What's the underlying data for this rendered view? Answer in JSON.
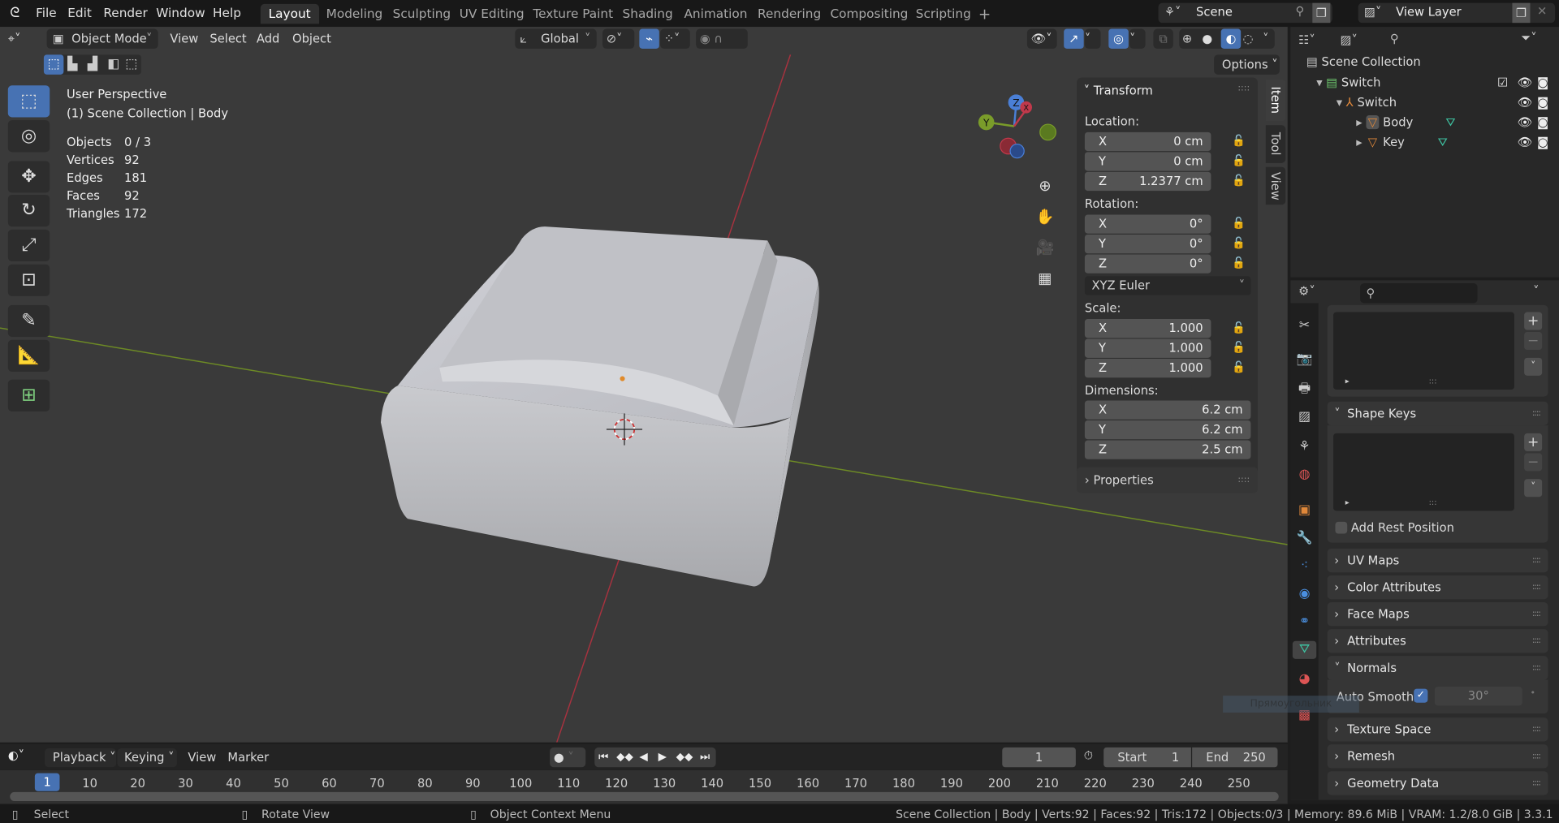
{
  "menu": [
    "File",
    "Edit",
    "Render",
    "Window",
    "Help"
  ],
  "workspaces": [
    "Layout",
    "Modeling",
    "Sculpting",
    "UV Editing",
    "Texture Paint",
    "Shading",
    "Animation",
    "Rendering",
    "Compositing",
    "Scripting"
  ],
  "active_workspace": "Layout",
  "add_workspace": "+",
  "scene": "Scene",
  "view_layer": "View Layer",
  "viewport_header": {
    "mode": "Object Mode",
    "menus": [
      "View",
      "Select",
      "Add",
      "Object"
    ],
    "orientation": "Global",
    "options": "Options"
  },
  "overlay_text": {
    "view": "User Perspective",
    "collection": "(1) Scene Collection | Body"
  },
  "stats": [
    {
      "label": "Objects",
      "value": "0 / 3"
    },
    {
      "label": "Vertices",
      "value": "92"
    },
    {
      "label": "Edges",
      "value": "181"
    },
    {
      "label": "Faces",
      "value": "92"
    },
    {
      "label": "Triangles",
      "value": "172"
    }
  ],
  "gizmo": {
    "x": "X",
    "y": "Y",
    "z": "Z"
  },
  "npanel": {
    "tabs": [
      "Item",
      "Tool",
      "View"
    ],
    "transform": "Transform",
    "location_label": "Location:",
    "location": [
      {
        "axis": "X",
        "value": "0 cm"
      },
      {
        "axis": "Y",
        "value": "0 cm"
      },
      {
        "axis": "Z",
        "value": "1.2377 cm"
      }
    ],
    "rotation_label": "Rotation:",
    "rotation": [
      {
        "axis": "X",
        "value": "0°"
      },
      {
        "axis": "Y",
        "value": "0°"
      },
      {
        "axis": "Z",
        "value": "0°"
      }
    ],
    "rotation_mode": "XYZ Euler",
    "scale_label": "Scale:",
    "scale": [
      {
        "axis": "X",
        "value": "1.000"
      },
      {
        "axis": "Y",
        "value": "1.000"
      },
      {
        "axis": "Z",
        "value": "1.000"
      }
    ],
    "dimensions_label": "Dimensions:",
    "dimensions": [
      {
        "axis": "X",
        "value": "6.2 cm"
      },
      {
        "axis": "Y",
        "value": "6.2 cm"
      },
      {
        "axis": "Z",
        "value": "2.5 cm"
      }
    ],
    "properties": "Properties"
  },
  "outliner": {
    "root": "Scene Collection",
    "items": [
      {
        "name": "Switch",
        "type": "collection"
      },
      {
        "name": "Switch",
        "type": "armature"
      },
      {
        "name": "Body",
        "type": "mesh"
      },
      {
        "name": "Key",
        "type": "mesh"
      }
    ]
  },
  "properties": {
    "shape_keys": "Shape Keys",
    "add_rest_position": "Add Rest Position",
    "panels_collapsed_top": [
      "UV Maps",
      "Color Attributes",
      "Face Maps",
      "Attributes"
    ],
    "normals": "Normals",
    "auto_smooth": "Auto Smooth",
    "auto_smooth_checked": true,
    "angle": "30°",
    "panels_collapsed_bottom": [
      "Texture Space",
      "Remesh",
      "Geometry Data"
    ],
    "tooltip": "Прямоугольник"
  },
  "timeline": {
    "menus": [
      "Playback",
      "Keying",
      "View",
      "Marker"
    ],
    "current_frame": "1",
    "start_label": "Start",
    "start": "1",
    "end_label": "End",
    "end": "250",
    "ticks": [
      "10",
      "20",
      "30",
      "40",
      "50",
      "60",
      "70",
      "80",
      "90",
      "100",
      "110",
      "120",
      "130",
      "140",
      "150",
      "160",
      "170",
      "180",
      "190",
      "200",
      "210",
      "220",
      "230",
      "240",
      "250"
    ]
  },
  "statusbar": {
    "select": "Select",
    "rotate": "Rotate View",
    "context": "Object Context Menu",
    "info": "Scene Collection | Body | Verts:92 | Faces:92 | Tris:172 | Objects:0/3 | Memory: 89.6 MiB | VRAM: 1.2/8.0 GiB | 3.3.1"
  },
  "colors": {
    "accent": "#4772b3",
    "x_axis": "#c0394b",
    "y_axis": "#7a9c2a",
    "z_axis": "#4a7fd6",
    "mesh_icon": "#e0883a",
    "vertex_group": "#3ec1a0"
  }
}
